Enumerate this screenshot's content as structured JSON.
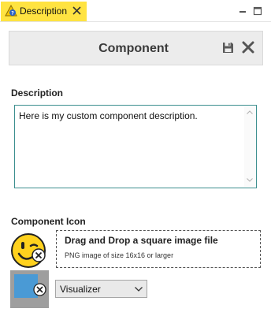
{
  "tab": {
    "label": "Description",
    "icon": "warning-info-icon"
  },
  "window_controls": {
    "minimize_icon": "minimize-icon",
    "maximize_icon": "maximize-icon"
  },
  "header": {
    "title": "Component",
    "save_icon": "save-icon",
    "close_icon": "close-icon"
  },
  "description": {
    "label": "Description",
    "value": "Here is my custom component description."
  },
  "component_icon": {
    "label": "Component Icon",
    "drop_title": "Drag and Drop a square image file",
    "drop_subtitle": "PNG image of size 16x16 or larger"
  },
  "view_select": {
    "selected": "Visualizer"
  },
  "colors": {
    "tab_bg": "#ffe341",
    "header_bg": "#ececec",
    "accent_border": "#3c8f8f",
    "tile_blue": "#4a9ad5",
    "smiley_yellow": "#ffd21e"
  }
}
